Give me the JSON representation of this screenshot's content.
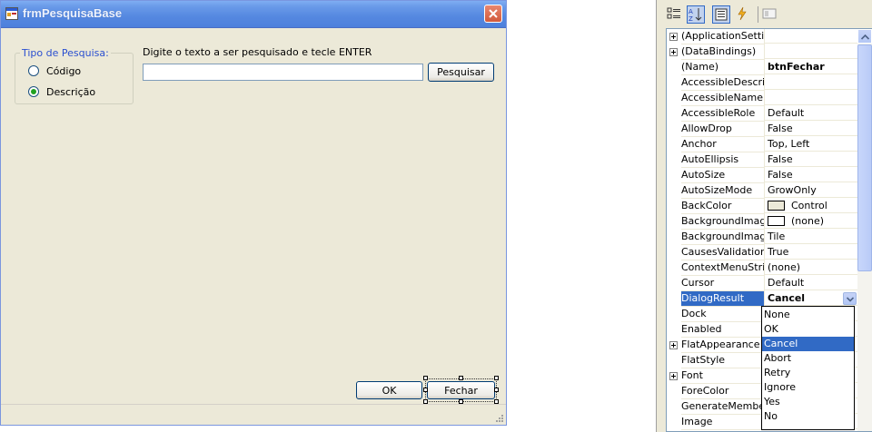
{
  "form": {
    "title": "frmPesquisaBase",
    "group_title": "Tipo de Pesquisa:",
    "radio_options": [
      {
        "label": "Código",
        "checked": false
      },
      {
        "label": "Descrição",
        "checked": true
      }
    ],
    "search_label": "Digite o texto a ser pesquisado e tecle ENTER",
    "search_value": "",
    "search_button": "Pesquisar",
    "ok_button": "OK",
    "close_button": "Fechar"
  },
  "properties": {
    "rows": [
      {
        "name": "(ApplicationSettings)",
        "value": "",
        "expandable": true
      },
      {
        "name": "(DataBindings)",
        "value": "",
        "expandable": true
      },
      {
        "name": "(Name)",
        "value": "btnFechar",
        "bold": true
      },
      {
        "name": "AccessibleDescription",
        "value": ""
      },
      {
        "name": "AccessibleName",
        "value": ""
      },
      {
        "name": "AccessibleRole",
        "value": "Default"
      },
      {
        "name": "AllowDrop",
        "value": "False"
      },
      {
        "name": "Anchor",
        "value": "Top, Left"
      },
      {
        "name": "AutoEllipsis",
        "value": "False"
      },
      {
        "name": "AutoSize",
        "value": "False"
      },
      {
        "name": "AutoSizeMode",
        "value": "GrowOnly"
      },
      {
        "name": "BackColor",
        "value": "Control",
        "swatch": "#ece9d8"
      },
      {
        "name": "BackgroundImage",
        "value": "(none)",
        "swatch": "#ffffff"
      },
      {
        "name": "BackgroundImageLayout",
        "value": "Tile"
      },
      {
        "name": "CausesValidation",
        "value": "True"
      },
      {
        "name": "ContextMenuStrip",
        "value": "(none)"
      },
      {
        "name": "Cursor",
        "value": "Default"
      },
      {
        "name": "DialogResult",
        "value": "Cancel",
        "bold": true,
        "selected": true,
        "dropdown": true
      },
      {
        "name": "Dock",
        "value": ""
      },
      {
        "name": "Enabled",
        "value": ""
      },
      {
        "name": "FlatAppearance",
        "value": "",
        "expandable": true
      },
      {
        "name": "FlatStyle",
        "value": ""
      },
      {
        "name": "Font",
        "value": "",
        "expandable": true
      },
      {
        "name": "ForeColor",
        "value": ""
      },
      {
        "name": "GenerateMember",
        "value": ""
      },
      {
        "name": "Image",
        "value": ""
      }
    ],
    "dialog_result_options": [
      "None",
      "OK",
      "Cancel",
      "Abort",
      "Retry",
      "Ignore",
      "Yes",
      "No"
    ],
    "dialog_result_selected": "Cancel"
  }
}
